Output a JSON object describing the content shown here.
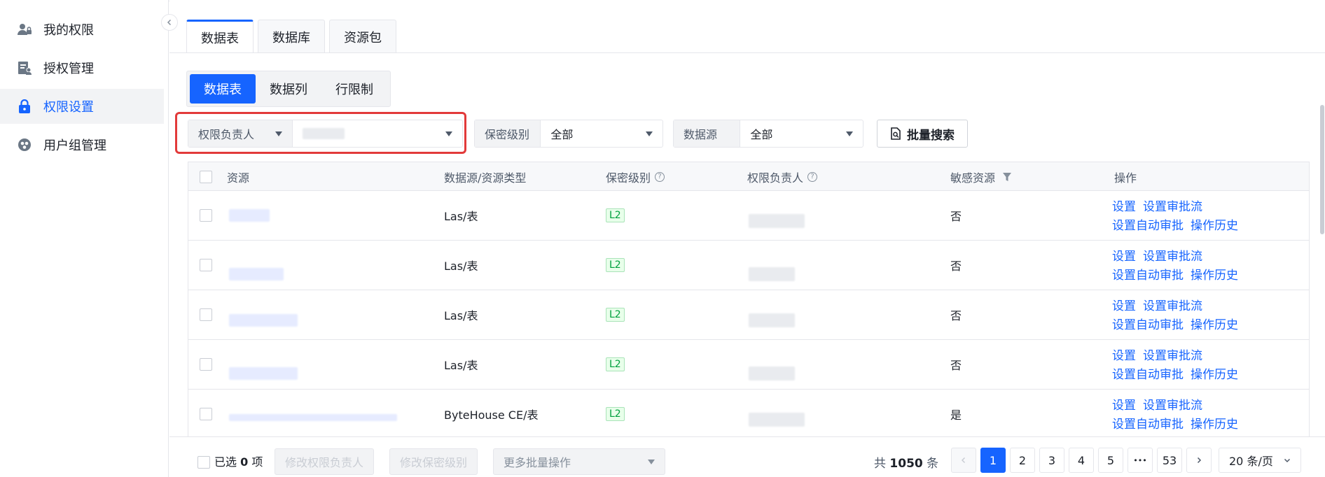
{
  "sidebar": {
    "items": [
      {
        "label": "我的权限",
        "icon": "user-lock-icon"
      },
      {
        "label": "授权管理",
        "icon": "document-user-icon"
      },
      {
        "label": "权限设置",
        "icon": "lock-icon"
      },
      {
        "label": "用户组管理",
        "icon": "group-icon"
      }
    ],
    "active_index": 2
  },
  "top_tabs": [
    "数据表",
    "数据库",
    "资源包"
  ],
  "sub_tabs": [
    "数据表",
    "数据列",
    "行限制"
  ],
  "filters": {
    "owner_label": "权限负责人",
    "security_label": "保密级别",
    "security_value": "全部",
    "source_label": "数据源",
    "source_value": "全部",
    "bulk_search": "批量搜索"
  },
  "table": {
    "headers": [
      "资源",
      "数据源/资源类型",
      "保密级别",
      "权限负责人",
      "敏感资源",
      "操作"
    ],
    "rows": [
      {
        "type": "Las/表",
        "level": "L2",
        "sensitive": "否"
      },
      {
        "type": "Las/表",
        "level": "L2",
        "sensitive": "否"
      },
      {
        "type": "Las/表",
        "level": "L2",
        "sensitive": "否"
      },
      {
        "type": "Las/表",
        "level": "L2",
        "sensitive": "否"
      },
      {
        "type": "ByteHouse CE/表",
        "level": "L2",
        "sensitive": "是"
      }
    ],
    "ops": {
      "set": "设置",
      "approval_flow": "设置审批流",
      "auto_approval": "设置自动审批",
      "history": "操作历史"
    }
  },
  "footer": {
    "selected_prefix": "已选",
    "selected_count": "0",
    "selected_suffix": "项",
    "change_owner": "修改权限负责人",
    "change_level": "修改保密级别",
    "more_ops": "更多批量操作",
    "total_prefix": "共",
    "total_count": "1050",
    "total_suffix": "条",
    "pages": [
      "1",
      "2",
      "3",
      "4",
      "5",
      "•••",
      "53"
    ],
    "page_size": "20 条/页"
  },
  "colors": {
    "primary": "#1664ff",
    "highlight_border": "#e23a3a",
    "tag_green": "#00a03e"
  }
}
